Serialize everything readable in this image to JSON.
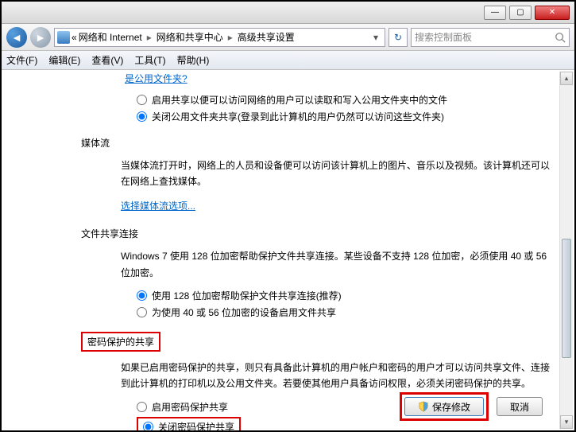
{
  "window": {
    "min": "—",
    "max": "▢",
    "close": "✕"
  },
  "breadcrumb": {
    "prefix": "«",
    "seg1": "网络和 Internet",
    "seg2": "网络和共享中心",
    "seg3": "高级共享设置"
  },
  "search": {
    "placeholder": "搜索控制面板"
  },
  "menu": {
    "file": "文件(F)",
    "edit": "编辑(E)",
    "view": "查看(V)",
    "tools": "工具(T)",
    "help": "帮助(H)"
  },
  "public_link": "是公用文件夹?",
  "public_radio": {
    "opt1": "启用共享以便可以访问网络的用户可以读取和写入公用文件夹中的文件",
    "opt2": "关闭公用文件夹共享(登录到此计算机的用户仍然可以访问这些文件夹)"
  },
  "media": {
    "heading": "媒体流",
    "para": "当媒体流打开时，网络上的人员和设备便可以访问该计算机上的图片、音乐以及视频。该计算机还可以在网络上查找媒体。",
    "link": "选择媒体流选项..."
  },
  "fileshare": {
    "heading": "文件共享连接",
    "para": "Windows 7 使用 128 位加密帮助保护文件共享连接。某些设备不支持 128 位加密，必须使用 40 或 56 位加密。",
    "opt1": "使用 128 位加密帮助保护文件共享连接(推荐)",
    "opt2": "为使用 40 或 56 位加密的设备启用文件共享"
  },
  "password": {
    "heading": "密码保护的共享",
    "para": "如果已启用密码保护的共享，则只有具备此计算机的用户帐户和密码的用户才可以访问共享文件、连接到此计算机的打印机以及公用文件夹。若要使其他用户具备访问权限，必须关闭密码保护的共享。",
    "opt1": "启用密码保护共享",
    "opt2": "关闭密码保护共享"
  },
  "buttons": {
    "save": "保存修改",
    "cancel": "取消"
  }
}
